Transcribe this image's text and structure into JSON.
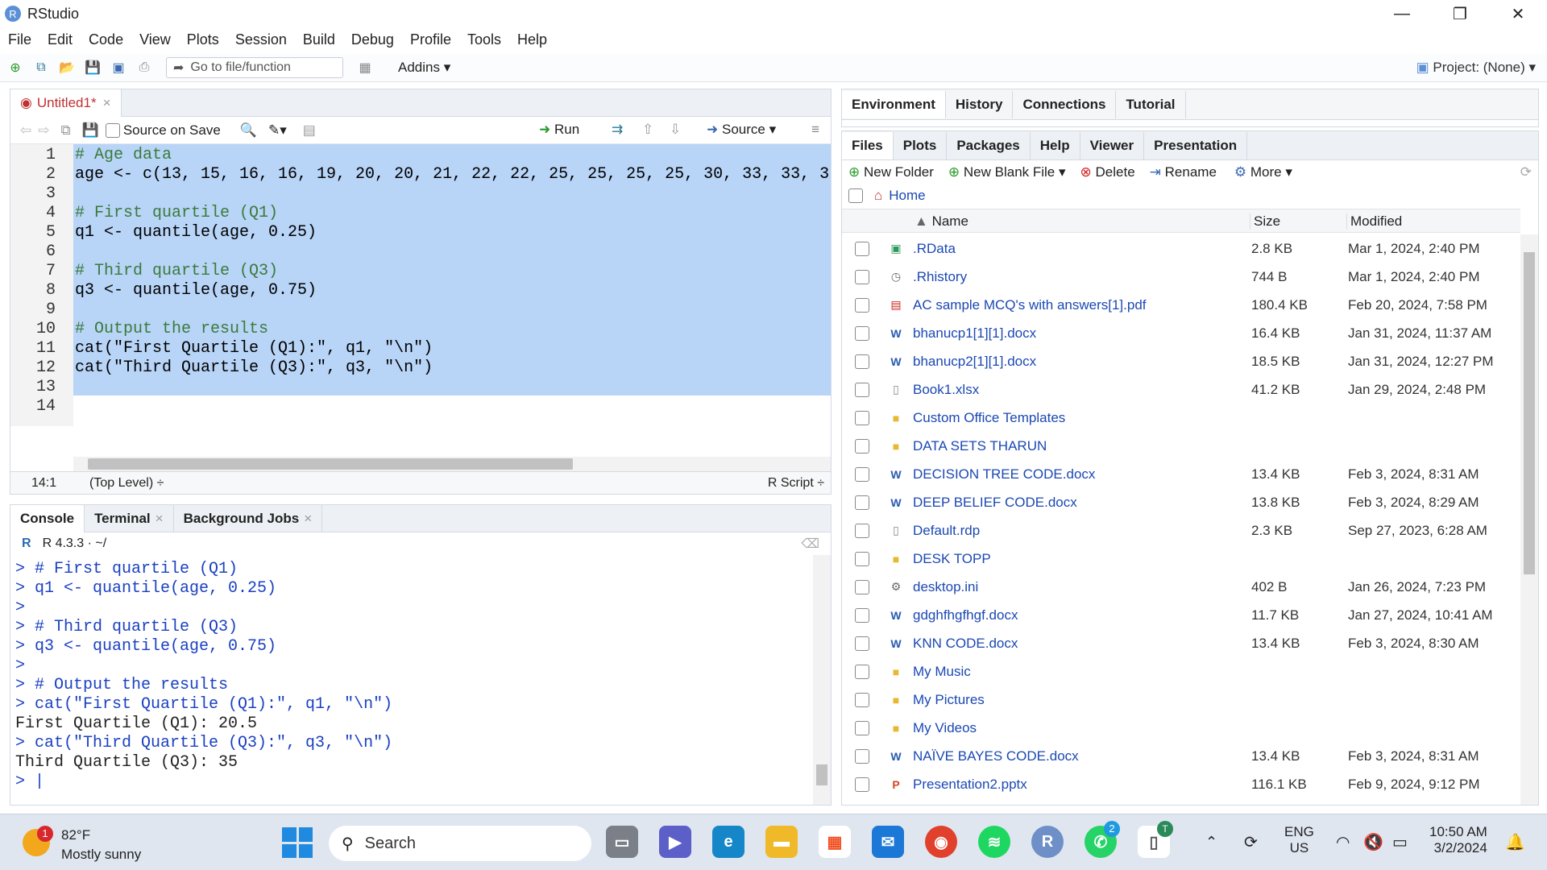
{
  "window": {
    "title": "RStudio"
  },
  "menu": [
    "File",
    "Edit",
    "Code",
    "View",
    "Plots",
    "Session",
    "Build",
    "Debug",
    "Profile",
    "Tools",
    "Help"
  ],
  "toolbar": {
    "goto_placeholder": "Go to file/function",
    "addins": "Addins",
    "project": "Project: (None)"
  },
  "editor": {
    "tab": "Untitled1*",
    "source_on_save": "Source on Save",
    "run": "Run",
    "source": "Source",
    "lines": [
      "# Age data",
      "age <- c(13, 15, 16, 16, 19, 20, 20, 21, 22, 22, 25, 25, 25, 25, 30, 33, 33, 3",
      "",
      "# First quartile (Q1)",
      "q1 <- quantile(age, 0.25)",
      "",
      "# Third quartile (Q3)",
      "q3 <- quantile(age, 0.75)",
      "",
      "# Output the results",
      "cat(\"First Quartile (Q1):\", q1, \"\\n\")",
      "cat(\"Third Quartile (Q3):\", q3, \"\\n\")",
      "",
      ""
    ],
    "line_numbers": [
      "1",
      "2",
      "3",
      "4",
      "5",
      "6",
      "7",
      "8",
      "9",
      "10",
      "11",
      "12",
      "13",
      "14"
    ],
    "status_pos": "14:1",
    "status_scope": "(Top Level) ÷",
    "status_type": "R Script ÷"
  },
  "console": {
    "tabs": [
      "Console",
      "Terminal",
      "Background Jobs"
    ],
    "version": "R 4.3.3 · ~/",
    "lines": [
      "> # First quartile (Q1)",
      "> q1 <- quantile(age, 0.25)",
      ">",
      "> # Third quartile (Q3)",
      "> q3 <- quantile(age, 0.75)",
      ">",
      "> # Output the results",
      "> cat(\"First Quartile (Q1):\", q1, \"\\n\")",
      "First Quartile (Q1): 20.5",
      "> cat(\"Third Quartile (Q3):\", q3, \"\\n\")",
      "Third Quartile (Q3): 35",
      "> |"
    ]
  },
  "env_pane": {
    "tabs": [
      "Environment",
      "History",
      "Connections",
      "Tutorial"
    ]
  },
  "files_pane": {
    "tabs": [
      "Files",
      "Plots",
      "Packages",
      "Help",
      "Viewer",
      "Presentation"
    ],
    "actions": {
      "new_folder": "New Folder",
      "new_blank_file": "New Blank File",
      "delete": "Delete",
      "rename": "Rename",
      "more": "More"
    },
    "breadcrumb": "Home",
    "headers": {
      "name": "Name",
      "size": "Size",
      "modified": "Modified"
    },
    "files": [
      {
        "icon": "r-data-icon",
        "name": ".RData",
        "size": "2.8 KB",
        "modified": "Mar 1, 2024, 2:40 PM"
      },
      {
        "icon": "history-icon",
        "name": ".Rhistory",
        "size": "744 B",
        "modified": "Mar 1, 2024, 2:40 PM"
      },
      {
        "icon": "pdf-icon",
        "name": "AC sample MCQ's with answers[1].pdf",
        "size": "180.4 KB",
        "modified": "Feb 20, 2024, 7:58 PM"
      },
      {
        "icon": "word-icon",
        "name": "bhanucp1[1][1].docx",
        "size": "16.4 KB",
        "modified": "Jan 31, 2024, 11:37 AM"
      },
      {
        "icon": "word-icon",
        "name": "bhanucp2[1][1].docx",
        "size": "18.5 KB",
        "modified": "Jan 31, 2024, 12:27 PM"
      },
      {
        "icon": "file-icon",
        "name": "Book1.xlsx",
        "size": "41.2 KB",
        "modified": "Jan 29, 2024, 2:48 PM"
      },
      {
        "icon": "folder-icon",
        "name": "Custom Office Templates",
        "size": "",
        "modified": ""
      },
      {
        "icon": "folder-icon",
        "name": "DATA SETS THARUN",
        "size": "",
        "modified": ""
      },
      {
        "icon": "word-icon",
        "name": "DECISION TREE CODE.docx",
        "size": "13.4 KB",
        "modified": "Feb 3, 2024, 8:31 AM"
      },
      {
        "icon": "word-icon",
        "name": "DEEP BELIEF CODE.docx",
        "size": "13.8 KB",
        "modified": "Feb 3, 2024, 8:29 AM"
      },
      {
        "icon": "file-icon",
        "name": "Default.rdp",
        "size": "2.3 KB",
        "modified": "Sep 27, 2023, 6:28 AM"
      },
      {
        "icon": "folder-icon",
        "name": "DESK TOPP",
        "size": "",
        "modified": ""
      },
      {
        "icon": "settings-file-icon",
        "name": "desktop.ini",
        "size": "402 B",
        "modified": "Jan 26, 2024, 7:23 PM"
      },
      {
        "icon": "word-icon",
        "name": "gdghfhgfhgf.docx",
        "size": "11.7 KB",
        "modified": "Jan 27, 2024, 10:41 AM"
      },
      {
        "icon": "word-icon",
        "name": "KNN CODE.docx",
        "size": "13.4 KB",
        "modified": "Feb 3, 2024, 8:30 AM"
      },
      {
        "icon": "folder-icon",
        "name": "My Music",
        "size": "",
        "modified": ""
      },
      {
        "icon": "folder-icon",
        "name": "My Pictures",
        "size": "",
        "modified": ""
      },
      {
        "icon": "folder-icon",
        "name": "My Videos",
        "size": "",
        "modified": ""
      },
      {
        "icon": "word-icon",
        "name": "NAÏVE BAYES CODE.docx",
        "size": "13.4 KB",
        "modified": "Feb 3, 2024, 8:31 AM"
      },
      {
        "icon": "ppt-icon",
        "name": "Presentation2.pptx",
        "size": "116.1 KB",
        "modified": "Feb 9, 2024, 9:12 PM"
      }
    ]
  },
  "taskbar": {
    "weather_temp": "82°F",
    "weather_desc": "Mostly sunny",
    "weather_badge": "1",
    "search": "Search",
    "lang1": "ENG",
    "lang2": "US",
    "time": "10:50 AM",
    "date": "3/2/2024",
    "whatsapp_badge": "2",
    "notepad_badge": "T"
  }
}
